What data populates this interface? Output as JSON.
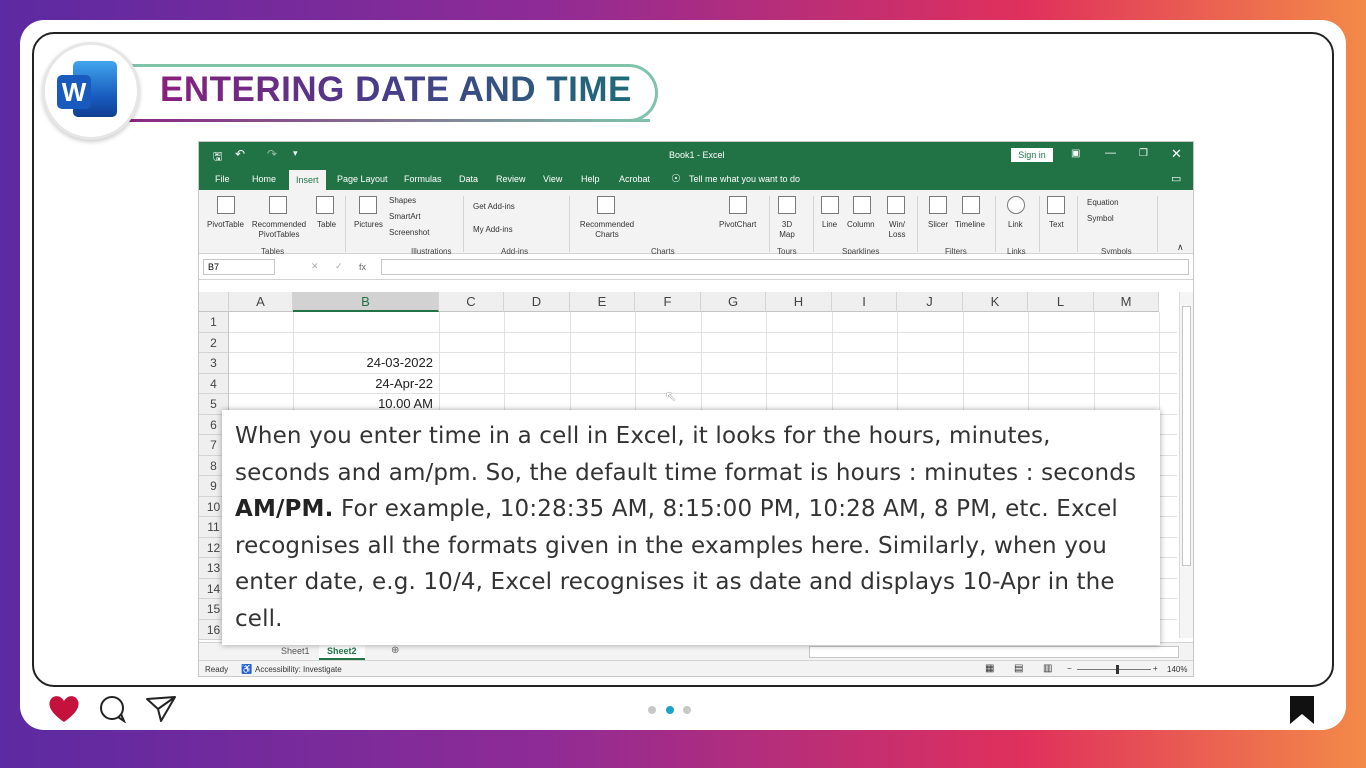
{
  "slide": {
    "title": "ENTERING DATE AND TIME",
    "logo_letter": "W",
    "accent_colors": {
      "purple": "#8a1f7f",
      "teal": "#1d6b78",
      "excel_green": "#217346",
      "active_dot": "#1aa3c8"
    }
  },
  "excel": {
    "window_title": "Book1  -  Excel",
    "sign_in": "Sign in",
    "menu": [
      "File",
      "Home",
      "Insert",
      "Page Layout",
      "Formulas",
      "Data",
      "Review",
      "View",
      "Help",
      "Acrobat"
    ],
    "active_menu": "Insert",
    "tell_me": "Tell me what you want to do",
    "ribbon": {
      "pivottable": "PivotTable",
      "recommended_pivottables": "Recommended PivotTables",
      "table": "Table",
      "pictures": "Pictures",
      "shapes": "Shapes",
      "smartart": "SmartArt",
      "screenshot": "Screenshot",
      "get_addins": "Get Add-ins",
      "my_addins": "My Add-ins",
      "recommended_charts": "Recommended Charts",
      "pivotchart": "PivotChart",
      "map3d": "3D Map",
      "line": "Line",
      "column": "Column",
      "winloss": "Win/ Loss",
      "slicer": "Slicer",
      "timeline": "Timeline",
      "link": "Link",
      "text": "Text",
      "equation": "Equation",
      "symbol": "Symbol",
      "groups": [
        "Tables",
        "Illustrations",
        "Add-ins",
        "Charts",
        "Tours",
        "Sparklines",
        "Filters",
        "Links",
        "Symbols"
      ]
    },
    "name_box": "B7",
    "fx": "fx",
    "columns": [
      "A",
      "B",
      "C",
      "D",
      "E",
      "F",
      "G",
      "H",
      "I",
      "J",
      "K",
      "L",
      "M"
    ],
    "rows": [
      "1",
      "2",
      "3",
      "4",
      "5",
      "6",
      "7",
      "8",
      "9",
      "10",
      "11",
      "12",
      "13",
      "14",
      "15",
      "16"
    ],
    "cells": {
      "B3": "24-03-2022",
      "B4": "24-Apr-22",
      "B5": "10.00 AM"
    },
    "sheets": [
      "Sheet1",
      "Sheet2"
    ],
    "active_sheet": "Sheet2",
    "status_ready": "Ready",
    "accessibility": "Accessibility: Investigate",
    "zoom": "140%"
  },
  "overlay": {
    "part1": "When you enter time in a cell in Excel, it looks for the hours, minutes, seconds and am/pm. So, the default time format is hours : minutes : seconds ",
    "bold": "AM/PM.",
    "part2": " For example, 10:28:35 AM, 8:15:00 PM, 10:28 AM, 8 PM, etc. Excel recognises all the formats given in the examples here. Similarly, when you enter date, e.g. 10/4, Excel recognises it as date and displays 10-Apr in the cell."
  },
  "footer": {
    "icons": [
      "heart-icon",
      "comment-icon",
      "send-icon",
      "bookmark-icon"
    ],
    "pagination": {
      "total": 3,
      "active": 2
    }
  }
}
